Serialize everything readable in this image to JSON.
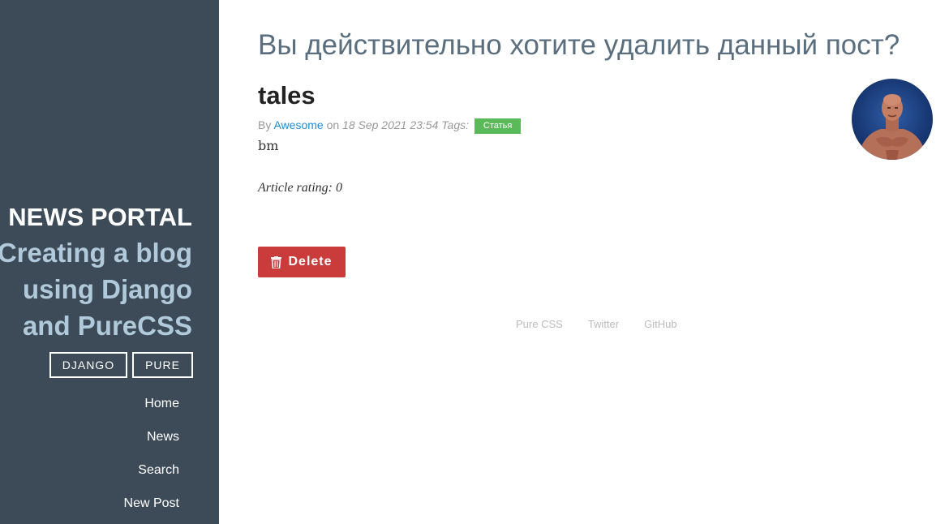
{
  "sidebar": {
    "title": "NEWS PORTAL",
    "tagline": "Creating a blog using Django and PureCSS",
    "buttons": [
      {
        "label": "DJANGO"
      },
      {
        "label": "PURE"
      }
    ],
    "nav": [
      {
        "label": "Home"
      },
      {
        "label": "News"
      },
      {
        "label": "Search"
      },
      {
        "label": "New Post"
      }
    ]
  },
  "main": {
    "page_title": "Вы действительно хотите удалить данный пост?",
    "post": {
      "title": "tales",
      "by_label": "By",
      "author": "Awesome",
      "on_label": "on",
      "date": "18 Sep 2021 23:54",
      "tags_label": "Tags:",
      "tag": "Статья",
      "body": "bm",
      "rating_text": "Article rating: 0"
    },
    "delete_label": "Delete"
  },
  "footer": {
    "links": [
      {
        "label": "Pure CSS"
      },
      {
        "label": "Twitter"
      },
      {
        "label": "GitHub"
      }
    ]
  },
  "colors": {
    "sidebar_bg": "#3d4b58",
    "tagline": "#b0cadb",
    "accent_link": "#1f8dd6",
    "tag_green": "#5aba59",
    "delete_red": "#ca3c3c"
  },
  "icons": {
    "delete": "trash-icon"
  }
}
